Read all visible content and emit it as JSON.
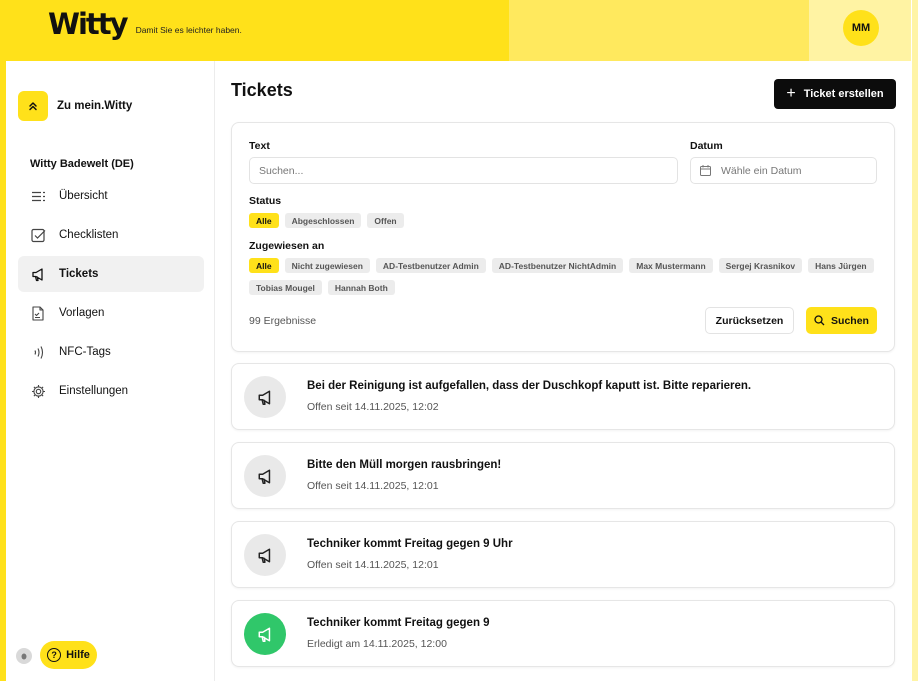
{
  "header": {
    "logo": "Witty",
    "tagline": "Damit Sie es leichter haben.",
    "avatar_initials": "MM"
  },
  "sidebar": {
    "back_label": "Zu mein.Witty",
    "org_name": "Witty Badewelt (DE)",
    "items": [
      {
        "label": "Übersicht",
        "icon": "list-icon"
      },
      {
        "label": "Checklisten",
        "icon": "checkbox-icon"
      },
      {
        "label": "Tickets",
        "icon": "megaphone-icon",
        "active": true
      },
      {
        "label": "Vorlagen",
        "icon": "template-icon"
      },
      {
        "label": "NFC-Tags",
        "icon": "nfc-icon"
      },
      {
        "label": "Einstellungen",
        "icon": "gear-icon"
      }
    ],
    "help_label": "Hilfe"
  },
  "main": {
    "title": "Tickets",
    "create_button": "Ticket erstellen",
    "filters": {
      "text_label": "Text",
      "text_placeholder": "Suchen...",
      "date_label": "Datum",
      "date_placeholder": "Wähle ein Datum",
      "status_label": "Status",
      "status_options": [
        "Alle",
        "Abgeschlossen",
        "Offen"
      ],
      "assigned_label": "Zugewiesen an",
      "assigned_options": [
        "Alle",
        "Nicht zugewiesen",
        "AD-Testbenutzer Admin",
        "AD-Testbenutzer NichtAdmin",
        "Max Mustermann",
        "Sergej Krasnikov",
        "Hans Jürgen",
        "Tobias Mougel",
        "Hannah Both"
      ],
      "result_count": "99 Ergebnisse",
      "reset_button": "Zurücksetzen",
      "search_button": "Suchen"
    },
    "tickets": [
      {
        "title": "Bei der Reinigung ist aufgefallen, dass der Duschkopf kaputt ist. Bitte reparieren.",
        "status": "Offen seit 14.11.2025, 12:02"
      },
      {
        "title": "Bitte den Müll morgen rausbringen!",
        "status": "Offen seit 14.11.2025, 12:01"
      },
      {
        "title": "Techniker kommt Freitag gegen 9 Uhr",
        "status": "Offen seit 14.11.2025, 12:01"
      },
      {
        "title": "Techniker kommt Freitag gegen 9",
        "status": "Erledigt am 14.11.2025, 12:00"
      }
    ]
  },
  "colors": {
    "brand_yellow": "#ffe11a",
    "done_green": "#30c76a",
    "dark_button": "#0c0c0c"
  }
}
